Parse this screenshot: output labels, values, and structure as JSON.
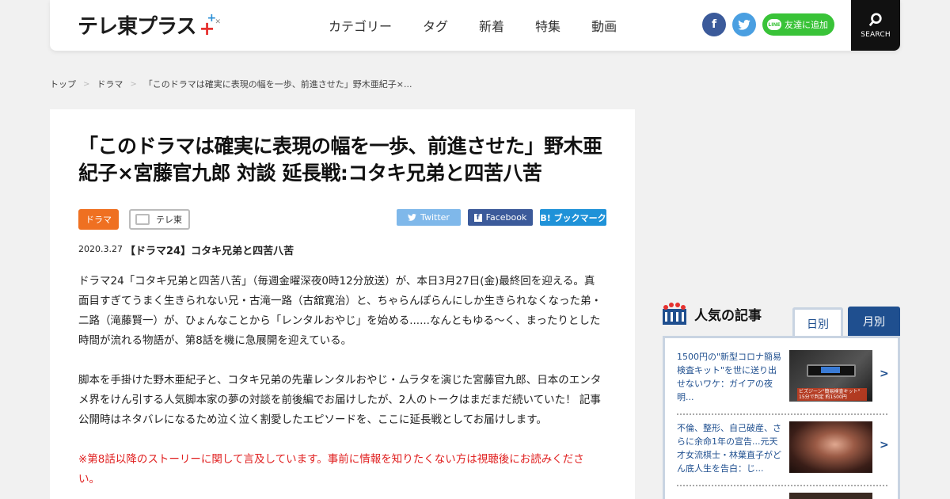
{
  "header": {
    "logo": "テレ東プラス",
    "logo_mark": "✕",
    "nav": [
      "カテゴリー",
      "タグ",
      "新着",
      "特集",
      "動画"
    ],
    "facebook_icon": "f",
    "line_badge": "LINE",
    "line_label": "友達に追加",
    "search_label": "SEARCH"
  },
  "breadcrumb": [
    "トップ",
    "ドラマ",
    "「このドラマは確実に表現の幅を一歩、前進させた」野木亜紀子×..."
  ],
  "article": {
    "title": "「このドラマは確実に表現の幅を一歩、前進させた」野木亜紀子×宮藤官九郎 対談 延長戦:コタキ兄弟と四苦八苦",
    "tag_genre": "ドラマ",
    "tag_channel": "テレ東",
    "share_twitter": "Twitter",
    "share_facebook": "Facebook",
    "share_hatena": "B! ブックマーク",
    "date": "2020.3.27",
    "subtitle": "【ドラマ24】コタキ兄弟と四苦八苦",
    "paragraph1": "ドラマ24「コタキ兄弟と四苦八苦」（毎週金曜深夜0時12分放送）が、本日3月27日(金)最終回を迎える。真面目すぎてうまく生きられない兄・古滝一路（古舘寛治）と、ちゃらんぽらんにしか生きられなくなった弟・二路（滝藤賢一）が、ひょんなことから「レンタルおやじ」を始める......なんともゆる～く、まったりとした時間が流れる物語が、第8話を機に急展開を迎えている。",
    "paragraph2": "脚本を手掛けた野木亜紀子と、コタキ兄弟の先輩レンタルおやじ・ムラタを演じた宮藤官九郎、日本のエンタメ界をけん引する人気脚本家の夢の対談を前後編でお届けしたが、2人のトークはまだまだ続いていた！ 記事公開時はネタバレになるため泣く泣く割愛したエピソードを、ここに延長戦としてお届けします。",
    "warning": "※第8話以降のストーリーに関して言及しています。事前に情報を知りたくない方は視聴後にお読みください。"
  },
  "sidebar": {
    "popular_title": "人気の記事",
    "tab_daily": "日別",
    "tab_monthly": "月別",
    "items": [
      {
        "text": "1500円の\"新型コロナ簡易検査キット\"を世に送り出せないワケ：ガイアの夜明..."
      },
      {
        "text": "不倫、整形、自己破産、さらに余命1年の宣告...元天才女流棋士・林葉直子がどん底人生を告白：じ..."
      }
    ],
    "thumb1_caption": "ビズジーン\"簡易検査キット\"",
    "thumb1_price": "15分で判定 約1500円"
  },
  "colors": {
    "accent_orange": "#ef7021",
    "navy": "#1f4f8f",
    "line_green": "#39c338",
    "warning_red": "#e02020"
  }
}
